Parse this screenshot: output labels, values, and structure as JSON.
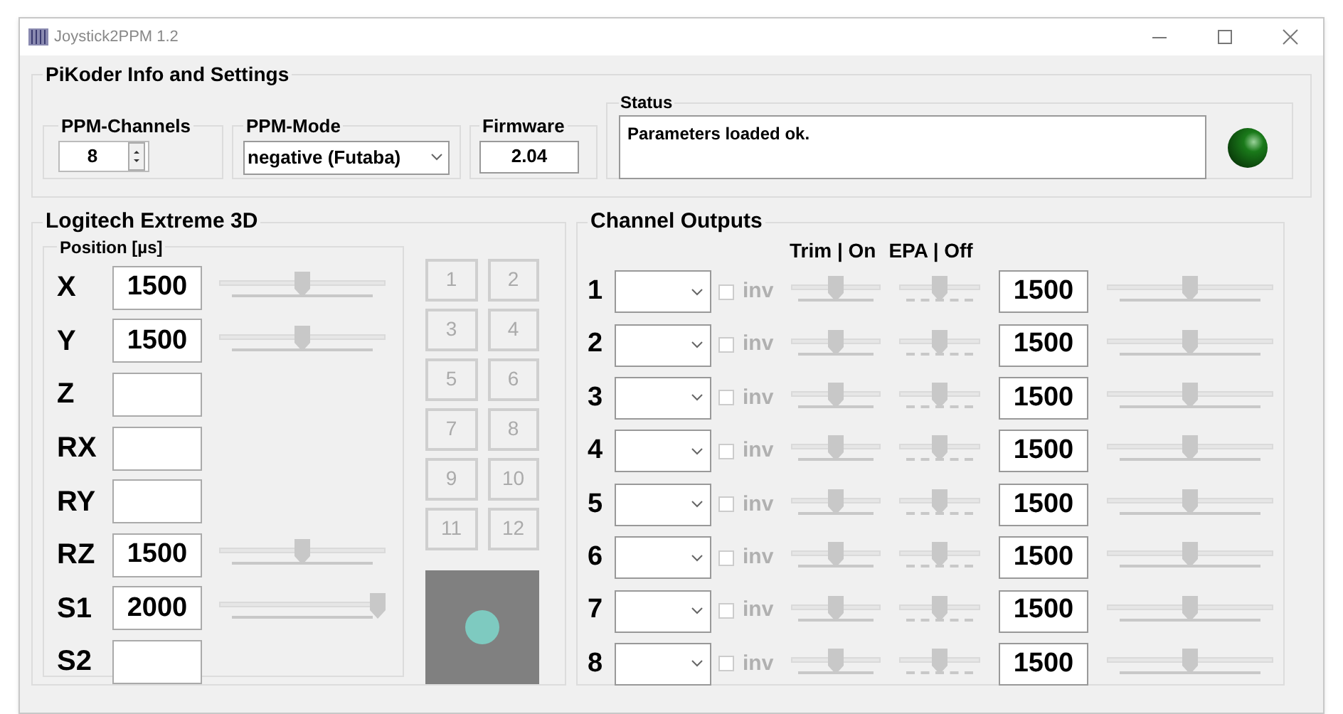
{
  "window": {
    "title": "Joystick2PPM 1.2"
  },
  "settings": {
    "title": "PiKoder Info and Settings",
    "ppm_channels": {
      "label": "PPM-Channels",
      "value": "8"
    },
    "ppm_mode": {
      "label": "PPM-Mode",
      "value": "negative (Futaba)"
    },
    "firmware": {
      "label": "Firmware",
      "value": "2.04"
    },
    "status": {
      "label": "Status",
      "message": "Parameters loaded ok.",
      "led_on": true
    }
  },
  "joystick": {
    "title": "Logitech Extreme 3D",
    "position_label": "Position [µs]",
    "axes": [
      {
        "label": "X",
        "value": "1500",
        "level": 0.5
      },
      {
        "label": "Y",
        "value": "1500",
        "level": 0.5
      },
      {
        "label": "Z"
      },
      {
        "label": "RX"
      },
      {
        "label": "RY"
      },
      {
        "label": "RZ",
        "value": "1500",
        "level": 0.5
      },
      {
        "label": "S1",
        "value": "2000",
        "level": 1
      },
      {
        "label": "S2"
      }
    ],
    "buttons": [
      "1",
      "2",
      "3",
      "4",
      "5",
      "6",
      "7",
      "8",
      "9",
      "10",
      "11",
      "12"
    ]
  },
  "channels": {
    "title": "Channel Outputs",
    "trim_header": "Trim | On",
    "epa_header": "EPA | Off",
    "rows": [
      {
        "number": "1",
        "inv": "inv",
        "checked": false,
        "trim": {
          "level": 0.5
        },
        "epa": {
          "level": 0.5
        },
        "value": "1500",
        "level": 0.5
      },
      {
        "number": "2",
        "inv": "inv",
        "checked": false,
        "trim": {
          "level": 0.5
        },
        "epa": {
          "level": 0.5
        },
        "value": "1500",
        "level": 0.5
      },
      {
        "number": "3",
        "inv": "inv",
        "checked": false,
        "trim": {
          "level": 0.5
        },
        "epa": {
          "level": 0.5
        },
        "value": "1500",
        "level": 0.5
      },
      {
        "number": "4",
        "inv": "inv",
        "checked": false,
        "trim": {
          "level": 0.5
        },
        "epa": {
          "level": 0.5
        },
        "value": "1500",
        "level": 0.5
      },
      {
        "number": "5",
        "inv": "inv",
        "checked": false,
        "trim": {
          "level": 0.5
        },
        "epa": {
          "level": 0.5
        },
        "value": "1500",
        "level": 0.5
      },
      {
        "number": "6",
        "inv": "inv",
        "checked": false,
        "trim": {
          "level": 0.5
        },
        "epa": {
          "level": 0.5
        },
        "value": "1500",
        "level": 0.5
      },
      {
        "number": "7",
        "inv": "inv",
        "checked": false,
        "trim": {
          "level": 0.5
        },
        "epa": {
          "level": 0.5
        },
        "value": "1500",
        "level": 0.5
      },
      {
        "number": "8",
        "inv": "inv",
        "checked": false,
        "trim": {
          "level": 0.5
        },
        "epa": {
          "level": 0.5
        },
        "value": "1500",
        "level": 0.5
      }
    ]
  }
}
